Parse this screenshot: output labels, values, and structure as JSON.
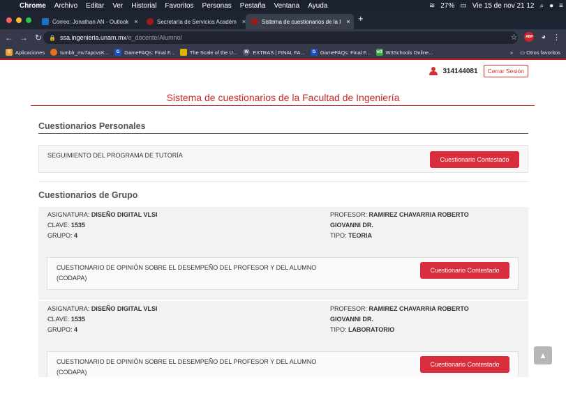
{
  "menubar": {
    "app": "Chrome",
    "items": [
      "Archivo",
      "Editar",
      "Ver",
      "Historial",
      "Favoritos",
      "Personas",
      "Pestaña",
      "Ventana",
      "Ayuda"
    ],
    "battery": "27%",
    "datetime": "Vie 15 de nov  21 12"
  },
  "tabs": [
    {
      "label": "Correo: Jonathan AN - Outlook",
      "color": "#1a73c8"
    },
    {
      "label": "Secretaría de Servicios Académ",
      "color": "#9b1b1b"
    },
    {
      "label": "Sistema de cuestionarios de la I",
      "color": "#9b1b1b"
    }
  ],
  "address": {
    "host": "ssa.ingenieria.unam.mx",
    "path": "/e_docente/Alumno/"
  },
  "bookmarks": [
    {
      "label": "Aplicaciones",
      "icon": "apps-icon",
      "color": "#e9a23b"
    },
    {
      "label": "tumblr_mv7apcvsK...",
      "icon": "tumblr-icon",
      "color": "#e8731b"
    },
    {
      "label": "GameFAQs: Final F...",
      "icon": "gamefaqs-icon",
      "color": "#1f4fbf"
    },
    {
      "label": "The Scale of the U...",
      "icon": "scale-icon",
      "color": "#e0b400"
    },
    {
      "label": "EXTRAS | FINAL FA...",
      "icon": "wordpress-icon",
      "color": "#55606e"
    },
    {
      "label": "GameFAQs: Final F...",
      "icon": "gamefaqs-icon",
      "color": "#1f4fbf"
    },
    {
      "label": "W3Schools Online...",
      "icon": "w3-icon",
      "color": "#43a047"
    }
  ],
  "bookmarks_more": "»",
  "other_bookmarks": "Otros favoritos",
  "user": {
    "id": "314144081",
    "logout": "Cerrar Sesión"
  },
  "site_title": "Sistema de cuestionarios de la Facultad de Ingeniería",
  "personal": {
    "title": "Cuestionarios Personales",
    "items": [
      {
        "name": "SEGUIMIENTO DEL PROGRAMA DE TUTORÍA",
        "status": "Cuestionario Contestado"
      }
    ]
  },
  "group": {
    "title": "Cuestionarios de Grupo",
    "labels": {
      "asignatura": "ASIGNATURA:",
      "clave": "CLAVE:",
      "grupo": "GRUPO:",
      "profesor": "PROFESOR:",
      "tipo": "TIPO:"
    },
    "items": [
      {
        "asignatura": "DISEÑO DIGITAL VLSI",
        "clave": "1535",
        "grupo": "4",
        "profesor_1": "RAMIREZ CHAVARRIA ROBERTO",
        "profesor_2": "GIOVANNI DR.",
        "tipo": "TEORIA",
        "questionnaire_1": "CUESTIONARIO DE OPINIÓN SOBRE EL DESEMPEÑO DEL PROFESOR Y DEL ALUMNO",
        "questionnaire_2": "(CODAPA)",
        "status": "Cuestionario Contestado"
      },
      {
        "asignatura": "DISEÑO DIGITAL VLSI",
        "clave": "1535",
        "grupo": "4",
        "profesor_1": "RAMIREZ CHAVARRIA ROBERTO",
        "profesor_2": "GIOVANNI DR.",
        "tipo": "LABORATORIO",
        "questionnaire_1": "CUESTIONARIO DE OPINIÓN SOBRE EL DESEMPEÑO DEL PROFESOR Y DEL ALUMNO",
        "questionnaire_2": "(CODAPA)",
        "status": "Cuestionario Contestado"
      }
    ]
  }
}
